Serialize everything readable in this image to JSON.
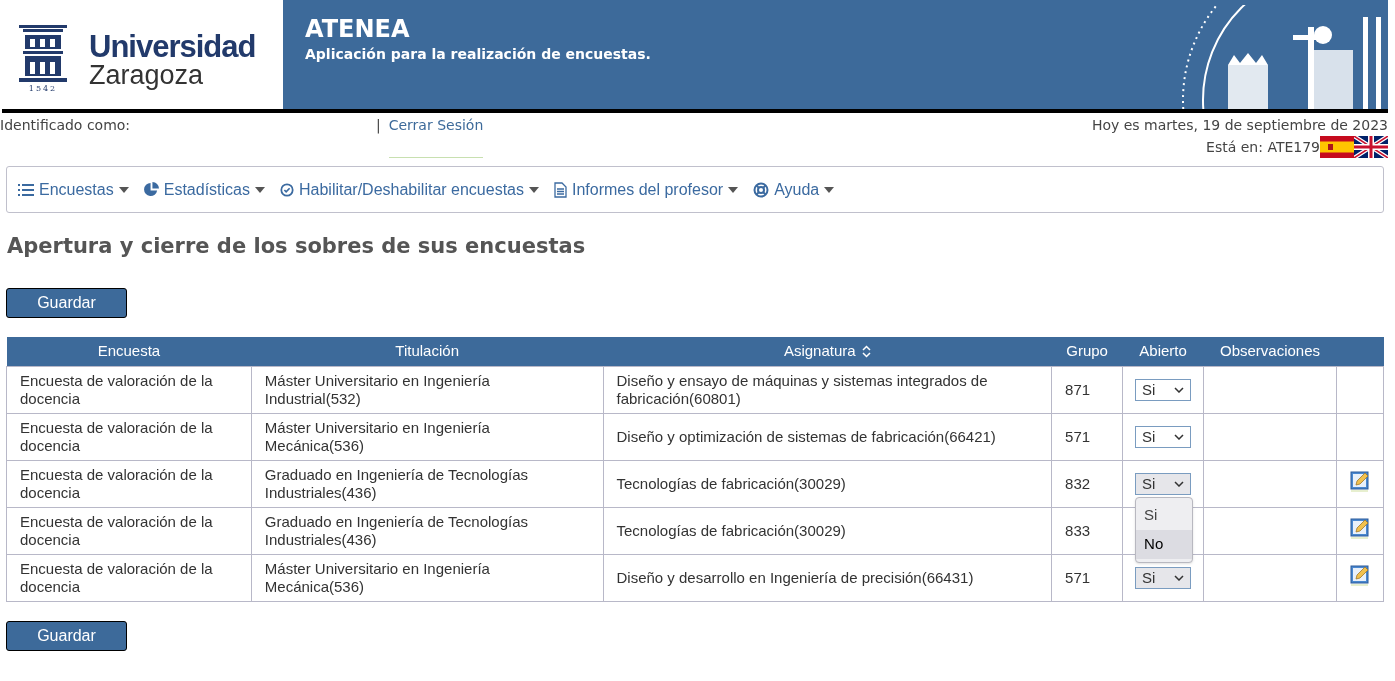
{
  "logo": {
    "name": "Universidad",
    "city": "Zaragoza",
    "year": "1542"
  },
  "banner": {
    "title": "ATENEA",
    "subtitle": "Aplicación para la realización de encuestas."
  },
  "user_bar": {
    "identified_label": "Identificado como:",
    "separator": "|",
    "logout": "Cerrar Sesión",
    "date": "Hoy es martes, 19 de septiembre de 2023",
    "location": "Está en: ATE179"
  },
  "menu": [
    {
      "kind": "list",
      "label": "Encuestas"
    },
    {
      "kind": "pie",
      "label": "Estadísticas"
    },
    {
      "kind": "check",
      "label": "Habilitar/Deshabilitar encuestas"
    },
    {
      "kind": "doc",
      "label": "Informes del profesor"
    },
    {
      "kind": "help",
      "label": "Ayuda"
    }
  ],
  "page_title": "Apertura y cierre de los sobres de sus encuestas",
  "save_button": "Guardar",
  "table": {
    "columns": [
      {
        "label": "Encuesta",
        "sortable": false
      },
      {
        "label": "Titulación",
        "sortable": false
      },
      {
        "label": "Asignatura",
        "sortable": true
      },
      {
        "label": "Grupo",
        "sortable": false
      },
      {
        "label": "Abierto",
        "sortable": false
      },
      {
        "label": "Observaciones",
        "sortable": false
      }
    ],
    "rows": [
      {
        "survey": "Encuesta de valoración de la docencia",
        "degree": "Máster Universitario en Ingeniería Industrial(532)",
        "subject": "Diseño y ensayo de máquinas y sistemas integrados de fabricación(60801)",
        "group": "871",
        "open": "Si",
        "shaded": false,
        "editable": false
      },
      {
        "survey": "Encuesta de valoración de la docencia",
        "degree": "Máster Universitario en Ingeniería Mecánica(536)",
        "subject": "Diseño y optimización de sistemas de fabricación(66421)",
        "group": "571",
        "open": "Si",
        "shaded": false,
        "editable": false
      },
      {
        "survey": "Encuesta de valoración de la docencia",
        "degree": "Graduado en Ingeniería de Tecnologías Industriales(436)",
        "subject": "Tecnologías de fabricación(30029)",
        "group": "832",
        "open": "Si",
        "shaded": true,
        "editable": true,
        "expanded": true,
        "options": [
          {
            "label": "Si",
            "selected": false
          },
          {
            "label": "No",
            "selected": true
          }
        ]
      },
      {
        "survey": "Encuesta de valoración de la docencia",
        "degree": "Graduado en Ingeniería de Tecnologías Industriales(436)",
        "subject": "Tecnologías de fabricación(30029)",
        "group": "833",
        "editable": true
      },
      {
        "survey": "Encuesta de valoración de la docencia",
        "degree": "Máster Universitario en Ingeniería Mecánica(536)",
        "subject": "Diseño y desarrollo en Ingeniería de precisión(66431)",
        "group": "571",
        "open": "Si",
        "shaded": true,
        "editable": true
      }
    ]
  },
  "save_button_bottom": "Guardar"
}
